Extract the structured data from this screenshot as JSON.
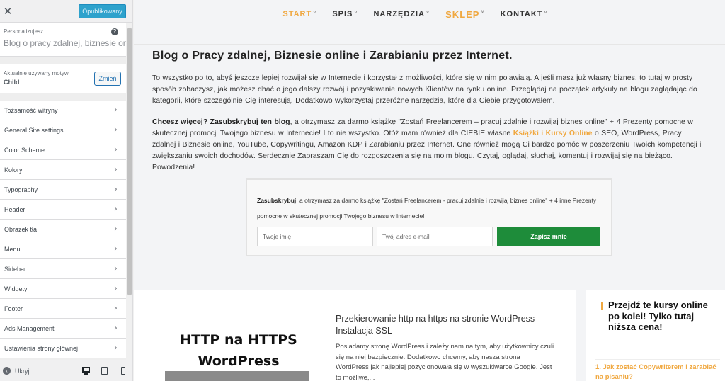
{
  "sidebar": {
    "close_icon": "close-icon",
    "publish_label": "Opublikowany",
    "info": {
      "small": "Personalizujesz",
      "title": "Blog o pracy zdalnej, biznesie online...",
      "help_glyph": "?"
    },
    "theme": {
      "small": "Aktualnie używany motyw",
      "name": "Child",
      "change_label": "Zmień"
    },
    "items": [
      {
        "label": "Tożsamość witryny"
      },
      {
        "label": "General Site settings"
      },
      {
        "label": "Color Scheme"
      },
      {
        "label": "Kolory"
      },
      {
        "label": "Typography"
      },
      {
        "label": "Header"
      },
      {
        "label": "Obrazek tła"
      },
      {
        "label": "Menu"
      },
      {
        "label": "Sidebar"
      },
      {
        "label": "Widgety"
      },
      {
        "label": "Footer"
      },
      {
        "label": "Ads Management"
      },
      {
        "label": "Ustawienia strony głównej"
      }
    ],
    "chevron": "›",
    "footer": {
      "hide_glyph": "‹",
      "hide_label": "Ukryj"
    }
  },
  "preview": {
    "nav": {
      "items": [
        {
          "label": "START",
          "caret": "˅"
        },
        {
          "label": "SPIS",
          "caret": "˅"
        },
        {
          "label": "NARZĘDZIA",
          "caret": "˅"
        },
        {
          "label": "SKLEP",
          "caret": "˅"
        },
        {
          "label": "KONTAKT",
          "caret": "˅"
        }
      ]
    },
    "title": "Blog o Pracy zdalnej, Biznesie online i Zarabianiu przez Internet.",
    "intro": "To wszystko po to, abyś jeszcze lepiej rozwijał się w Internecie i korzystał z możliwości, które się w nim pojawiają. A jeśli masz już własny biznes, to tutaj w prosty sposób zobaczysz, jak możesz dbać o jego dalszy rozwój i pozyskiwanie nowych Klientów na rynku online. Przeglądaj na początek artykuły na blogu zaglądając do kategorii, które szczególnie Cię interesują. Dodatkowo wykorzystaj przeróżne narzędzia, które dla Ciebie przygotowałem.",
    "cta": {
      "bold": "Chcesz więcej? Zasubskrybuj ten blog",
      "text1": ", a otrzymasz za darmo książkę \"Zostań Freelancerem – pracuj zdalnie i rozwijaj biznes online\" + 4 Prezenty pomocne w skutecznej promocji Twojego biznesu w Internecie! I to nie wszystko. Otóż mam również dla CIEBIE własne ",
      "link": "Książki i Kursy Online",
      "text2": " o SEO, WordPress, Pracy zdalnej i Biznesie online, YouTube, Copywritingu, Amazon KDP i Zarabianiu przez Internet. One również mogą Ci bardzo pomóc w poszerzeniu Twoich kompetencji i zwiększaniu swoich dochodów. Serdecznie Zapraszam Cię do rozgoszczenia się na moim blogu. Czytaj, oglądaj, słuchaj, komentuj i rozwijaj się na bieżąco. Powodzenia!"
    },
    "subscribe": {
      "bold": "Zasubskrybuj",
      "text": ", a otrzymasz za darmo książkę \"Zostań Freelancerem - pracuj zdalnie i rozwijaj biznes online\" + 4 inne Prezenty pomocne w skutecznej promocji Twojego biznesu w Internecie!",
      "name_placeholder": "Twoje imię",
      "email_placeholder": "Twój adres e-mail",
      "button_label": "Zapisz mnie"
    },
    "post": {
      "thumb_line1": "HTTP na HTTPS",
      "thumb_line2": "WordPress",
      "title": "Przekierowanie http na https na stronie WordPress - Instalacja SSL",
      "excerpt": "Posiadamy stronę WordPress i zależy nam na tym, aby użytkownicy czuli się na niej bezpiecznie. Dodatkowo chcemy, aby nasza strona WordPress jak najlepiej pozycjonowała się w wyszukiwarce Google. Jest to możliwe,..."
    },
    "widget": {
      "title": "Przejdź te kursy online po kolei! Tylko tutaj niższa cena!",
      "first_link": "1. Jak zostać Copywriterem i zarabiać na pisaniu?"
    }
  }
}
